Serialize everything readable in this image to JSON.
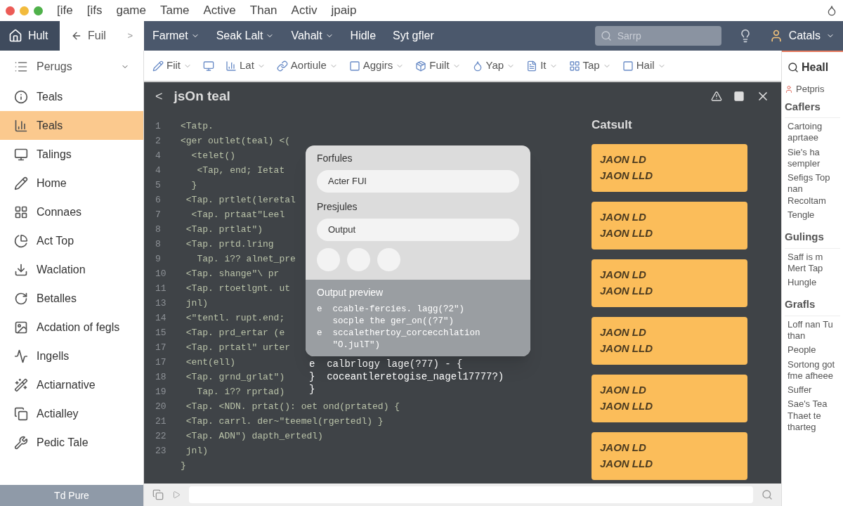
{
  "menu_bar": {
    "items": [
      "[ife",
      "[ifs",
      "game",
      "Tame",
      "Active",
      "Than",
      "Activ",
      "jpaip"
    ]
  },
  "nav_bar": {
    "home": "Hult",
    "back_tab": "Fuil",
    "tab_arrow": ">",
    "items": [
      {
        "label": "Farmet",
        "dropdown": true
      },
      {
        "label": "Seak Lalt",
        "dropdown": true
      },
      {
        "label": "Vahalt",
        "dropdown": true
      },
      {
        "label": "Hidle",
        "dropdown": false
      },
      {
        "label": "Syt gfler",
        "dropdown": false
      }
    ],
    "search": {
      "placeholder": "Sarrp"
    },
    "user": "Catals"
  },
  "sidebar": {
    "header": "Perugs",
    "items": [
      {
        "label": "Teals",
        "selected": false
      },
      {
        "label": "Teals",
        "selected": true
      },
      {
        "label": "Talings",
        "selected": false
      },
      {
        "label": "Home",
        "selected": false
      },
      {
        "label": "Connaes",
        "selected": false
      },
      {
        "label": "Act Top",
        "selected": false
      },
      {
        "label": "Waclation",
        "selected": false
      },
      {
        "label": "Betalles",
        "selected": false
      },
      {
        "label": "Acdation of fegls",
        "selected": false
      },
      {
        "label": "Ingells",
        "selected": false
      },
      {
        "label": "Actiarnative",
        "selected": false
      },
      {
        "label": "Actialley",
        "selected": false
      },
      {
        "label": "Pedic Tale",
        "selected": false
      }
    ],
    "footer": "Td Pure"
  },
  "toolbar": {
    "items": [
      {
        "label": "Fiit",
        "dropdown": true
      },
      {
        "dropdown": false
      },
      {
        "label": "Lat",
        "dropdown": true
      },
      {
        "label": "Aortiule",
        "dropdown": true
      },
      {
        "label": "Aggirs",
        "dropdown": true
      },
      {
        "label": "Fuilt",
        "dropdown": true
      },
      {
        "label": "Yap",
        "dropdown": true
      },
      {
        "label": "It",
        "dropdown": true
      },
      {
        "label": "Tap",
        "dropdown": true
      },
      {
        "label": "Hail",
        "dropdown": true
      }
    ]
  },
  "editor": {
    "title": "jsOn teal",
    "back": "<",
    "code": [
      {
        "n": "1",
        "text": "<Tatp."
      },
      {
        "n": "2",
        "text": "<ger outlet(teal) <("
      },
      {
        "n": "4",
        "text": "  <telet()"
      },
      {
        "n": "4",
        "text": "   <Tap, end; Ietat"
      },
      {
        "n": "5",
        "text": "  }"
      },
      {
        "n": "6",
        "text": " <Tap. prtlet(leretal"
      },
      {
        "n": "7",
        "text": "  <Tap. prtaat\"Leel"
      },
      {
        "n": "8",
        "text": " <Tap. prtlat\")"
      },
      {
        "n": "8",
        "text": " <Tap. prtd.lring"
      },
      {
        "n": "9",
        "text": "   Tap. i?? alnet_pre"
      },
      {
        "n": "10",
        "text": " <Tap. shange\"\\ pr"
      },
      {
        "n": "11",
        "text": " <Tap. rtoetlgnt. ut"
      },
      {
        "n": "13",
        "text": " jnl)"
      },
      {
        "n": "14",
        "text": " <\"tentl. rupt.end;"
      },
      {
        "n": "15",
        "text": " <Tap. prd_ertar (e"
      },
      {
        "n": "17",
        "text": " <Tap. prtatl\" urter"
      },
      {
        "n": "17",
        "text": " <ent(ell)"
      },
      {
        "n": "18",
        "text": " <Tap. grnd_grlat\")"
      },
      {
        "n": "19",
        "text": "   Tap. i?? rprtad)"
      },
      {
        "n": "20",
        "text": " <Tap. <NDN. prtat(): oet ond(prtated) {"
      },
      {
        "n": "21",
        "text": " <Tap. carrl. der~\"teemel(rgertedl) }"
      },
      {
        "n": "22",
        "text": " <Tap. ADN\") dapth_ertedl)"
      },
      {
        "n": "23",
        "text": " jnl)"
      },
      {
        "text": "}"
      }
    ],
    "output_tail": [
      "e  calbrlogy lage(?77) - {",
      "}  coceantleretogise_nagel17777?)",
      "}"
    ],
    "output": {
      "title": "Catsult",
      "cards": [
        [
          "JAON LD",
          "JAON LLD"
        ],
        [
          "JAON LD",
          "JAON LLD"
        ],
        [
          "JAON LD",
          "JAON LLD"
        ],
        [
          "JAON LD",
          "JAON LLD"
        ],
        [
          "JAON LD",
          "JAON LLD"
        ],
        [
          "JAON LD",
          "JAON LLD"
        ]
      ]
    }
  },
  "popup": {
    "field_1": {
      "label": "Forfules",
      "value": "Acter FUI"
    },
    "field_2": {
      "label": "Presjules",
      "value": "Output"
    },
    "preview_title": "Output preview",
    "preview_lines": [
      "e  ccable-fercies. lagg(?2\")",
      "   socple the ger_on((?7\")",
      "e  sccalethertoy_corcecchlation",
      "   \"O.julT\")"
    ]
  },
  "right_panel": {
    "tab": "Heall",
    "title": "Petpris",
    "sections": [
      {
        "heading": "Caflers",
        "items": [
          "Cartoing aprtaee",
          "Sie's ha sempler",
          "Sefigs Top nan Recoltam",
          "Tengle"
        ]
      },
      {
        "heading": "Gulings",
        "items": [
          "Saff is m Mert Tap",
          "Hungle"
        ]
      },
      {
        "heading": "Grafls",
        "items": [
          "Loff nan Tu than",
          "People",
          "Sortong got fme afheee",
          "Suffer",
          "Sae's Tea Thaet te tharteg"
        ]
      }
    ]
  }
}
